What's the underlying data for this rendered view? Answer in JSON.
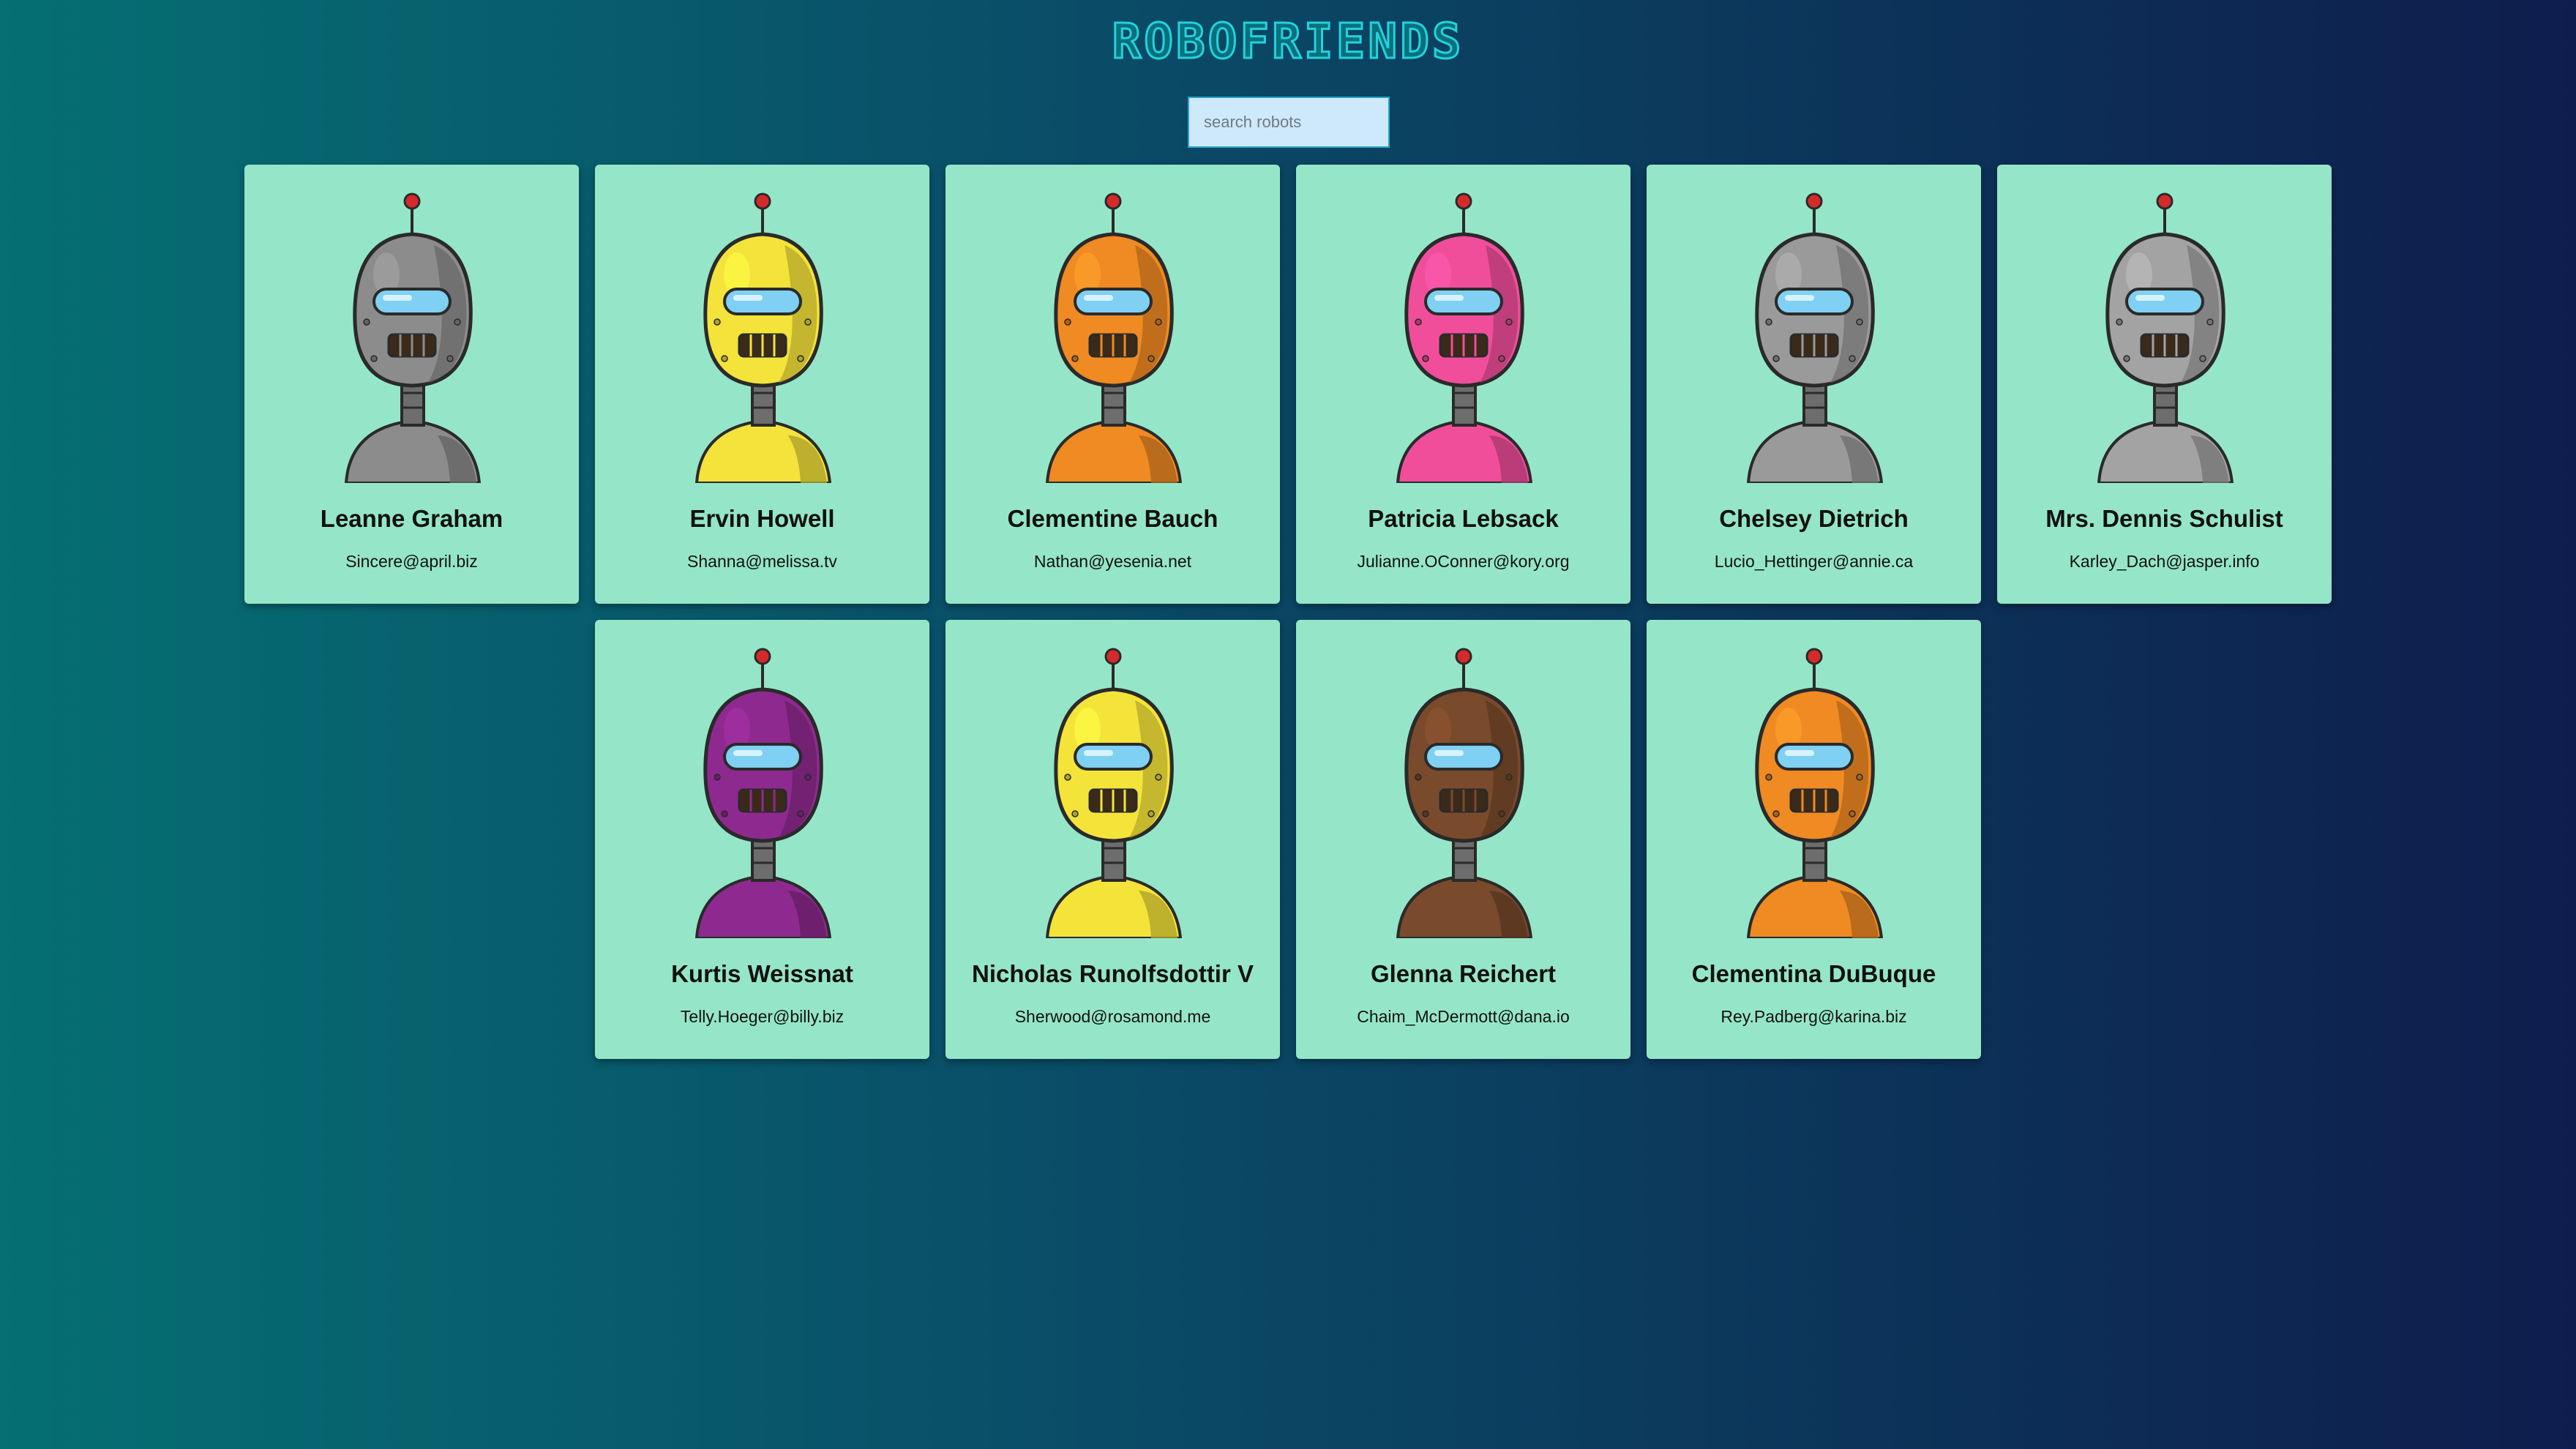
{
  "app": {
    "title": "ROBOFRIENDS"
  },
  "search": {
    "placeholder": "search robots",
    "value": ""
  },
  "robots": [
    {
      "name": "Leanne Graham",
      "email": "Sincere@april.biz",
      "color": "#8c8c8c",
      "avatar": "robot-avatar-gray-antenna"
    },
    {
      "name": "Ervin Howell",
      "email": "Shanna@melissa.tv",
      "color": "#f3e33a",
      "avatar": "robot-avatar-yellow-spike"
    },
    {
      "name": "Clementine Bauch",
      "email": "Nathan@yesenia.net",
      "color": "#f08a23",
      "avatar": "robot-avatar-orange-wires"
    },
    {
      "name": "Patricia Lebsack",
      "email": "Julianne.OConner@kory.org",
      "color": "#f04e9a",
      "avatar": "robot-avatar-pink-eye"
    },
    {
      "name": "Chelsey Dietrich",
      "email": "Lucio_Hettinger@annie.ca",
      "color": "#9a9a9a",
      "avatar": "robot-avatar-gray-red-eye"
    },
    {
      "name": "Mrs. Dennis Schulist",
      "email": "Karley_Dach@jasper.info",
      "color": "#a3a3a3",
      "avatar": "robot-avatar-gray-cap"
    },
    {
      "name": "Kurtis Weissnat",
      "email": "Telly.Hoeger@billy.biz",
      "color": "#8e2a8f",
      "avatar": "robot-avatar-purple-visor"
    },
    {
      "name": "Nicholas Runolfsdottir V",
      "email": "Sherwood@rosamond.me",
      "color": "#f4e43a",
      "avatar": "robot-avatar-yellow-visor"
    },
    {
      "name": "Glenna Reichert",
      "email": "Chaim_McDermott@dana.io",
      "color": "#7a4a2c",
      "avatar": "robot-avatar-brown-red-eye"
    },
    {
      "name": "Clementina DuBuque",
      "email": "Rey.Padberg@karina.biz",
      "color": "#f08a23",
      "avatar": "robot-avatar-orange-mustache"
    }
  ]
}
